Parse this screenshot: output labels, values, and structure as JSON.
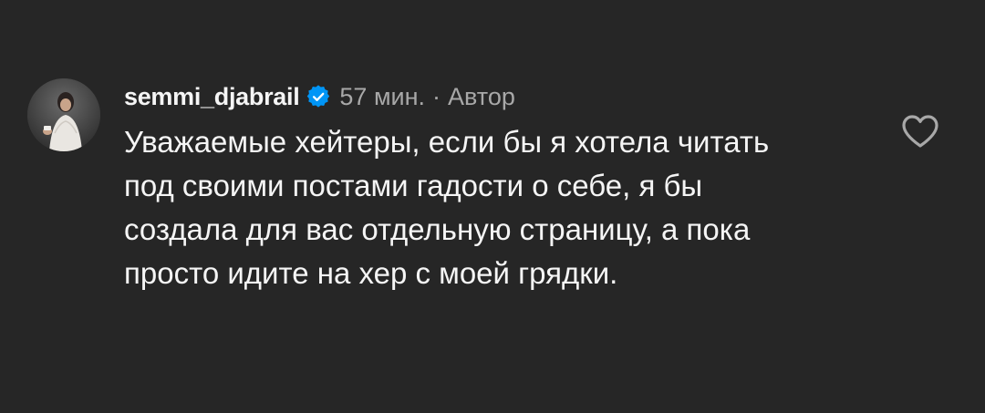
{
  "comment": {
    "username": "semmi_djabrail",
    "verified": true,
    "time": "57 мин.",
    "separator": "·",
    "author_label": "Автор",
    "text": "Уважаемые хейтеры, если бы я хотела читать под своими постами гадости о себе, я бы создала для вас отдельную страницу, а пока просто идите на хер с моей грядки.",
    "icons": {
      "avatar": "avatar",
      "verified": "verified-badge-icon",
      "like": "heart-outline-icon"
    }
  },
  "colors": {
    "background": "#262626",
    "primary_text": "#f5f5f5",
    "secondary_text": "#a8a8a8",
    "verified_badge": "#0095f6"
  }
}
